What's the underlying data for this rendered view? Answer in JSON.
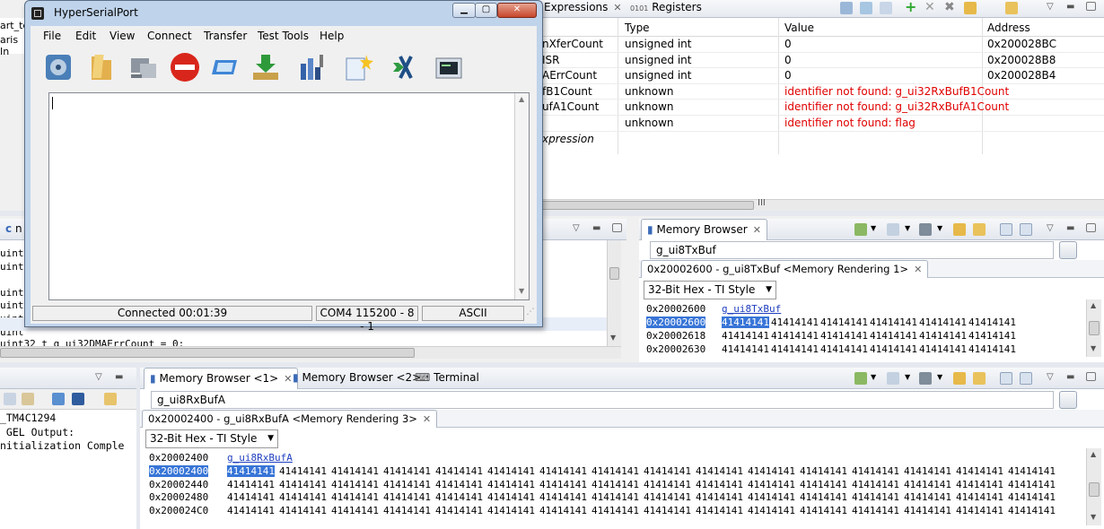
{
  "expr_view": {
    "tabs": [
      {
        "label": "Expressions"
      },
      {
        "label": "Registers"
      }
    ],
    "columns": {
      "type": "Type",
      "value": "Value",
      "address": "Address"
    },
    "rows": [
      {
        "name": "nXferCount",
        "type": "unsigned int",
        "value": "0",
        "address": "0x200028BC",
        "error": false
      },
      {
        "name": "ISR",
        "type": "unsigned int",
        "value": "0",
        "address": "0x200028B8",
        "error": false
      },
      {
        "name": "AErrCount",
        "type": "unsigned int",
        "value": "0",
        "address": "0x200028B4",
        "error": false
      },
      {
        "name": "fB1Count",
        "type": "unknown",
        "value": "identifier not found: g_ui32RxBufB1Count",
        "address": "",
        "error": true
      },
      {
        "name": "ufA1Count",
        "type": "unknown",
        "value": "identifier not found: g_ui32RxBufA1Count",
        "address": "",
        "error": true
      },
      {
        "name": "",
        "type": "unknown",
        "value": "identifier not found: flag",
        "address": "",
        "error": true
      }
    ],
    "add_new": "xpression"
  },
  "left_bg": {
    "top_lines": [
      "art_te",
      "aris In"
    ],
    "code_tab": "n",
    "code_lines": [
      "uint",
      "uint",
      "",
      "uint",
      "uint",
      "uint",
      "uint",
      ""
    ],
    "code_bottom": "uint32_t g_ui32DMAErrCount = 0;",
    "console_lines": [
      "_TM4C1294",
      " GEL Output:",
      "nitialization Comple"
    ]
  },
  "mem1": {
    "tab_label": "Memory Browser",
    "address_input": "g_ui8TxBuf",
    "rendering_tab": "0x20002600 - g_ui8TxBuf <Memory Rendering 1>",
    "format": "32-Bit Hex - TI Style",
    "lines": [
      {
        "addr": "0x20002600",
        "symbol": "g_ui8TxBuf",
        "words": [],
        "selected": false
      },
      {
        "addr": "0x20002600",
        "symbol": "",
        "words": [
          "41414141",
          "41414141",
          "41414141",
          "41414141",
          "41414141",
          "41414141"
        ],
        "selected": true
      },
      {
        "addr": "0x20002618",
        "symbol": "",
        "words": [
          "41414141",
          "41414141",
          "41414141",
          "41414141",
          "41414141",
          "41414141"
        ],
        "selected": false
      },
      {
        "addr": "0x20002630",
        "symbol": "",
        "words": [
          "41414141",
          "41414141",
          "41414141",
          "41414141",
          "41414141",
          "41414141"
        ],
        "selected": false
      }
    ]
  },
  "mem2": {
    "tabs": [
      {
        "label": "Memory Browser <1>"
      },
      {
        "label": "Memory Browser <2>"
      },
      {
        "label": "Terminal"
      }
    ],
    "address_input": "g_ui8RxBufA",
    "rendering_tab": "0x20002400 - g_ui8RxBufA <Memory Rendering 3>",
    "format": "32-Bit Hex - TI Style",
    "lines": [
      {
        "addr": "0x20002400",
        "symbol": "g_ui8RxBufA",
        "words": [],
        "selected": false
      },
      {
        "addr": "0x20002400",
        "symbol": "",
        "words": [
          "41414141",
          "41414141",
          "41414141",
          "41414141",
          "41414141",
          "41414141",
          "41414141",
          "41414141",
          "41414141",
          "41414141",
          "41414141",
          "41414141",
          "41414141",
          "41414141",
          "41414141",
          "41414141"
        ],
        "selected": true
      },
      {
        "addr": "0x20002440",
        "symbol": "",
        "words": [
          "41414141",
          "41414141",
          "41414141",
          "41414141",
          "41414141",
          "41414141",
          "41414141",
          "41414141",
          "41414141",
          "41414141",
          "41414141",
          "41414141",
          "41414141",
          "41414141",
          "41414141",
          "41414141"
        ],
        "selected": false
      },
      {
        "addr": "0x20002480",
        "symbol": "",
        "words": [
          "41414141",
          "41414141",
          "41414141",
          "41414141",
          "41414141",
          "41414141",
          "41414141",
          "41414141",
          "41414141",
          "41414141",
          "41414141",
          "41414141",
          "41414141",
          "41414141",
          "41414141",
          "41414141"
        ],
        "selected": false
      },
      {
        "addr": "0x200024C0",
        "symbol": "",
        "words": [
          "41414141",
          "41414141",
          "41414141",
          "41414141",
          "41414141",
          "41414141",
          "41414141",
          "41414141",
          "41414141",
          "41414141",
          "41414141",
          "41414141",
          "41414141",
          "41414141",
          "41414141",
          "41414141"
        ],
        "selected": false
      }
    ]
  },
  "hsp": {
    "title": "HyperSerialPort",
    "menu": [
      "File",
      "Edit",
      "View",
      "Connect",
      "Transfer",
      "Test Tools",
      "Help"
    ],
    "toolbar_icons": [
      "disk-icon",
      "folder-icon",
      "computer-icon",
      "disconnect-icon",
      "card-icon",
      "download-icon",
      "tools-icon",
      "new-file-icon",
      "hex-icon",
      "terminal-icon"
    ],
    "status": {
      "connected": "Connected 00:01:39",
      "port": "COM4  115200 - 8 - 1",
      "mode": "ASCII"
    }
  },
  "colors": {
    "selection": "#3875d7",
    "error": "#e00000",
    "symbol": "#1f3fbf"
  }
}
